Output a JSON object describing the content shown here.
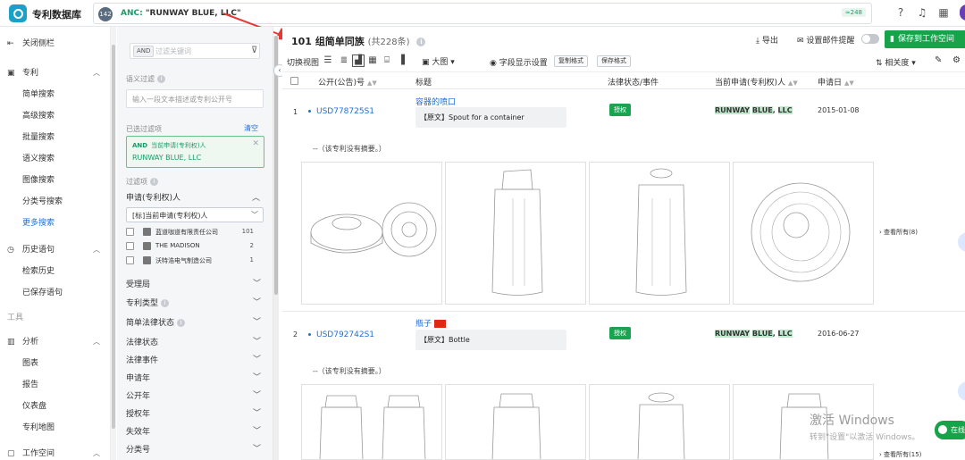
{
  "header": {
    "brand": "专利数据库",
    "query_count": "142",
    "query_key": "ANC:",
    "query_value": "\"RUNWAY BLUE, LLC\"",
    "hit_count": "≈248"
  },
  "leftnav": {
    "collapse": "关闭侧栏",
    "patent_group": "专利",
    "items": [
      "简单搜索",
      "高级搜索",
      "批量搜索",
      "语义搜索",
      "图像搜索",
      "分类号搜索",
      "更多搜索"
    ],
    "history_group": "历史语句",
    "history_items": [
      "检索历史",
      "已保存语句"
    ],
    "tools_section": "工具",
    "analysis_group": "分析",
    "analysis_items": [
      "图表",
      "报告",
      "仪表盘",
      "专利地图"
    ],
    "workspace_group": "工作空间"
  },
  "filter": {
    "and_tag": "AND",
    "search_placeholder": "过滤关键词",
    "semantic_label": "语义过滤",
    "semantic_placeholder": "输入一段文本描述或专利公开号",
    "selected_label": "已选过滤项",
    "clear": "清空",
    "chip_and": "AND",
    "chip_field": "当前申请(专利权)人",
    "chip_value": "RUNWAY BLUE, LLC",
    "filter_items_label": "过滤项",
    "applicant_section": "申请(专利权)人",
    "applicant_select": "[标]当前申请(专利权)人",
    "options": [
      {
        "name": "蓝道咖道有限责任公司",
        "count": "101"
      },
      {
        "name": "THE MADISON",
        "count": "2"
      },
      {
        "name": "沃特浩电气制造公司",
        "count": "1"
      }
    ],
    "sections": [
      "受理局",
      "专利类型",
      "简单法律状态",
      "法律状态",
      "法律事件",
      "申请年",
      "公开年",
      "授权年",
      "失效年",
      "分类号"
    ]
  },
  "main": {
    "title_count": "101",
    "title_text": "组简单同族",
    "title_total": "(共228条)",
    "export": "导出",
    "email_alert": "设置邮件提醒",
    "save_workspace": "保存到工作空间",
    "switch_view": "切换视图",
    "big_image": "大图",
    "field_settings": "字段显示设置",
    "copy_format": "复制格式",
    "save_format": "保存格式",
    "relevance": "相关度",
    "columns": [
      "公开(公告)号",
      "标题",
      "法律状态/事件",
      "当前申请(专利权)人",
      "申请日"
    ]
  },
  "rows": [
    {
      "num": "1",
      "pub_no": "USD778725S1",
      "title": "容器的喷口",
      "original": "【原文】Spout for a container",
      "status": "授权",
      "applicant_a": "RUNWAY",
      "applicant_b": "BLUE",
      "applicant_c": "LLC",
      "date": "2015-01-08",
      "abstract": "--（该专利没有摘要。）",
      "view_all": "查看所有(8)"
    },
    {
      "num": "2",
      "pub_no": "USD792742S1",
      "title": "瓶子",
      "original": "【原文】Bottle",
      "status": "授权",
      "applicant_a": "RUNWAY",
      "applicant_b": "BLUE",
      "applicant_c": "LLC",
      "date": "2016-06-27",
      "abstract": "--（该专利没有摘要。）",
      "view_all": "查看所有(15)"
    }
  ],
  "overlay": {
    "watermark": "激活 Windows",
    "watermark_sub": "转到\"设置\"以激活 Windows。",
    "chat": "在线"
  },
  "colors": {
    "accent_green": "#17a34a",
    "link_blue": "#1f6fd6",
    "highlight_green": "#bfe8cc",
    "annotation_red": "#e53935"
  }
}
